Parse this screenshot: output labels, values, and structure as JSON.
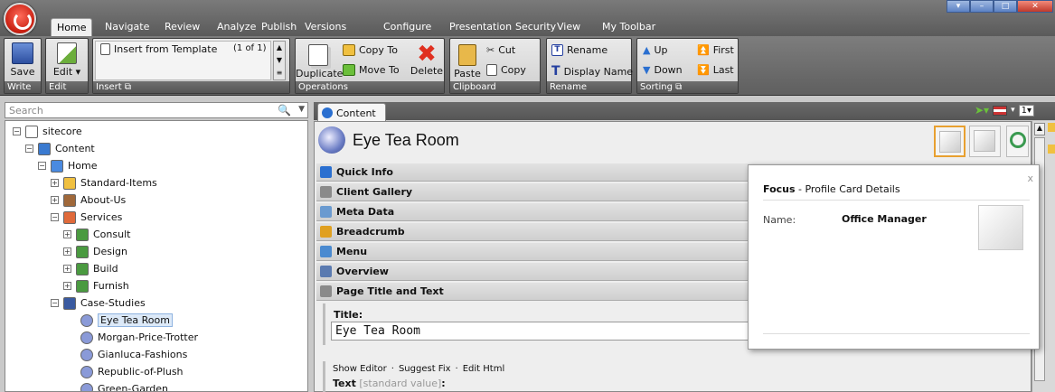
{
  "ribbon": {
    "tabs": [
      "Home",
      "Navigate",
      "Review",
      "Analyze",
      "Publish",
      "Versions",
      "Configure",
      "Presentation",
      "Security",
      "View",
      "My Toolbar"
    ],
    "active_tab": "Home",
    "groups": {
      "write": {
        "label": "Write",
        "save": "Save"
      },
      "edit": {
        "label": "Edit",
        "edit": "Edit"
      },
      "insert": {
        "label": "Insert",
        "item": "Insert from Template",
        "count": "(1 of 1)"
      },
      "operations": {
        "label": "Operations",
        "duplicate": "Duplicate",
        "copy_to": "Copy To",
        "move_to": "Move To",
        "delete": "Delete"
      },
      "clipboard": {
        "label": "Clipboard",
        "paste": "Paste",
        "cut": "Cut",
        "copy": "Copy"
      },
      "rename": {
        "label": "Rename",
        "rename": "Rename",
        "display_name": "Display Name"
      },
      "sorting": {
        "label": "Sorting",
        "up": "Up",
        "down": "Down",
        "first": "First",
        "last": "Last"
      }
    }
  },
  "search": {
    "placeholder": "Search"
  },
  "tree": [
    {
      "label": "sitecore",
      "level": 0,
      "exp": "−"
    },
    {
      "label": "Content",
      "level": 1,
      "exp": "−"
    },
    {
      "label": "Home",
      "level": 2,
      "exp": "−"
    },
    {
      "label": "Standard-Items",
      "level": 3,
      "exp": "+"
    },
    {
      "label": "About-Us",
      "level": 3,
      "exp": "+"
    },
    {
      "label": "Services",
      "level": 3,
      "exp": "−"
    },
    {
      "label": "Consult",
      "level": 4,
      "exp": "+"
    },
    {
      "label": "Design",
      "level": 4,
      "exp": "+"
    },
    {
      "label": "Build",
      "level": 4,
      "exp": "+"
    },
    {
      "label": "Furnish",
      "level": 4,
      "exp": "+"
    },
    {
      "label": "Case-Studies",
      "level": 3,
      "exp": "−"
    },
    {
      "label": "Eye Tea Room",
      "level": 4,
      "exp": ""
    },
    {
      "label": "Morgan-Price-Trotter",
      "level": 4,
      "exp": ""
    },
    {
      "label": "Gianluca-Fashions",
      "level": 4,
      "exp": ""
    },
    {
      "label": "Republic-of-Plush",
      "level": 4,
      "exp": ""
    },
    {
      "label": "Green-Garden",
      "level": 4,
      "exp": ""
    }
  ],
  "content": {
    "tab": "Content",
    "item_title": "Eye Tea Room",
    "sections": [
      "Quick Info",
      "Client Gallery",
      "Meta Data",
      "Breadcrumb",
      "Menu",
      "Overview",
      "Page Title and Text"
    ],
    "title_label": "Title:",
    "title_value": "Eye Tea Room",
    "editor_links": [
      "Show Editor",
      "Suggest Fix",
      "Edit Html"
    ],
    "text_label": "Text",
    "text_std": "[standard value]",
    "colon": ":",
    "lang_count": "1"
  },
  "popup": {
    "heading_bold": "Focus",
    "heading_rest": " - Profile Card Details",
    "name_label": "Name:",
    "name_value": "Office Manager",
    "close": "x"
  }
}
